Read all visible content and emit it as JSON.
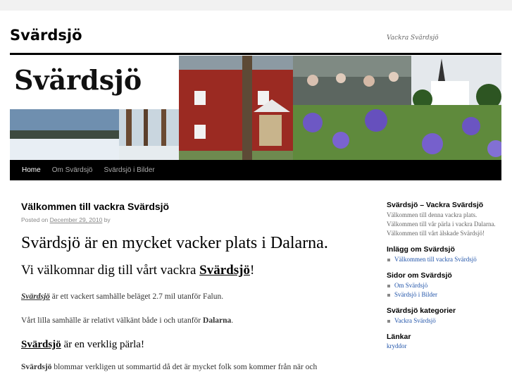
{
  "site": {
    "title": "Svärdsjö",
    "description": "Vackra Svärdsjö",
    "banner_text": "Svärdsjö"
  },
  "nav": {
    "items": [
      {
        "label": "Home"
      },
      {
        "label": "Om Svärdsjö"
      },
      {
        "label": "Svärdsjö i Bilder"
      }
    ]
  },
  "post": {
    "title": "Välkommen till vackra Svärdsjö",
    "meta_prefix": "Posted on",
    "date": "December 29, 2010",
    "meta_by": "by",
    "heading1": "Svärdsjö är en mycket vacker plats i Dalarna.",
    "heading2_pre": "Vi välkomnar dig till vårt vackra ",
    "heading2_link": "Svärdsjö",
    "heading2_post": "!",
    "p1_link": "Svärdsjö",
    "p1_rest": " är ett vackert samhälle beläget 2.7 mil utanför Falun.",
    "p2_pre": "Vårt lilla samhälle är relativt välkänt både i och utanför ",
    "p2_bold": "Dalarna",
    "p2_post": ".",
    "heading3_link": "Svärdsjö",
    "heading3_rest": " är en verklig pärla!",
    "p3_bold": "Svärdsjö",
    "p3_rest": " blommar verkligen ut sommartid då det är mycket folk som kommer från när och"
  },
  "sidebar": {
    "about_title": "Svärdsjö – Vackra Svärdsjö",
    "about_text": "Välkommen till denna vackra plats. Välkommen till vår pärla i vackra Dalarna. Välkommen till vårt älskade Svärdsjö!",
    "posts_title": "Inlägg om Svärdsjö",
    "posts": [
      "Välkommen till vackra Svärdsjö"
    ],
    "pages_title": "Sidor om Svärdsjö",
    "pages": [
      "Om Svärdsjö",
      "Svärdsjö i Bilder"
    ],
    "categories_title": "Svärdsjö kategorier",
    "categories": [
      "Vackra Svärdsjö"
    ],
    "links_title": "Länkar",
    "links": [
      "kryddor"
    ]
  },
  "colors": {
    "link": "#2255aa",
    "nav_bg": "#000000",
    "page_bg": "#f1f1f1"
  }
}
